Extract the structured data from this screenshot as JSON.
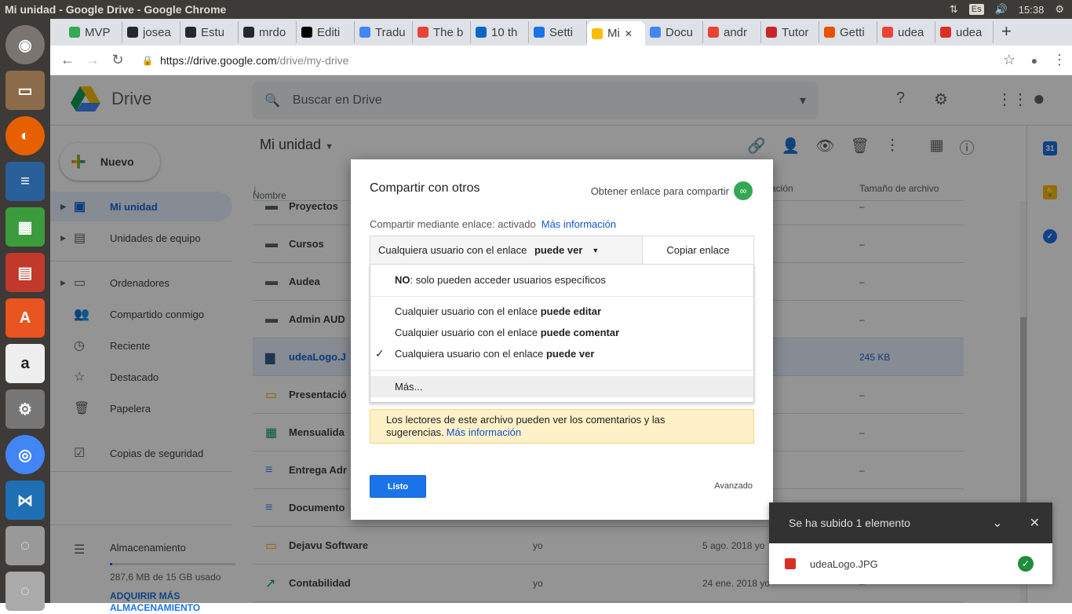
{
  "window": {
    "title": "Mi unidad - Google Drive - Google Chrome",
    "keyboard": "Es",
    "clock": "15:38"
  },
  "tabs": [
    {
      "label": "MVP",
      "color": "#34a853"
    },
    {
      "label": "josea",
      "color": "#24292e"
    },
    {
      "label": "Estu",
      "color": "#24292e"
    },
    {
      "label": "mrdo",
      "color": "#24292e"
    },
    {
      "label": "Editi",
      "color": "#000000"
    },
    {
      "label": "Tradu",
      "color": "#4285f4"
    },
    {
      "label": "The b",
      "color": "#ea4335"
    },
    {
      "label": "10 th",
      "color": "#0a66c2"
    },
    {
      "label": "Setti",
      "color": "#1a73e8"
    },
    {
      "label": "Mi",
      "color": "#fbbc04",
      "active": true
    },
    {
      "label": "Docu",
      "color": "#4285f4"
    },
    {
      "label": "andr",
      "color": "#ea4335"
    },
    {
      "label": "Tutor",
      "color": "#c62828"
    },
    {
      "label": "Getti",
      "color": "#e65100"
    },
    {
      "label": "udea",
      "color": "#ea4335"
    },
    {
      "label": "udea",
      "color": "#d93025"
    }
  ],
  "address": {
    "host": "https://drive.google.com",
    "path": "/drive/my-drive"
  },
  "drive": {
    "app_name": "Drive",
    "search_placeholder": "Buscar en Drive",
    "new_label": "Nuevo",
    "sidebar": [
      {
        "label": "Mi unidad",
        "icon": "drive-folder-icon",
        "selected": true,
        "arrow": true
      },
      {
        "label": "Unidades de equipo",
        "icon": "team-drive-icon",
        "arrow": true
      },
      {
        "label": "Ordenadores",
        "icon": "computers-icon",
        "arrow": true
      },
      {
        "label": "Compartido conmigo",
        "icon": "shared-icon"
      },
      {
        "label": "Reciente",
        "icon": "clock-icon"
      },
      {
        "label": "Destacado",
        "icon": "star-icon"
      },
      {
        "label": "Papelera",
        "icon": "trash-icon"
      },
      {
        "label": "Copias de seguridad",
        "icon": "backup-icon"
      }
    ],
    "storage": {
      "label": "Almacenamiento",
      "used": "287,6 MB de 15 GB usado",
      "buy": "ADQUIRIR MÁS ALMACENAMIENTO",
      "fraction": 0.019
    },
    "title": "Mi unidad",
    "columns": {
      "name": "Nombre",
      "modified": "ación",
      "size": "Tamaño de archivo"
    },
    "files": [
      {
        "name": "Proyectos",
        "icon": "folder-icon",
        "owner": "",
        "modified": "",
        "size": "–"
      },
      {
        "name": "Cursos",
        "icon": "folder-icon",
        "owner": "",
        "modified": "",
        "size": "–"
      },
      {
        "name": "Audea",
        "icon": "shared-folder-icon",
        "owner": "",
        "modified": "",
        "size": "–"
      },
      {
        "name": "Admin AUD",
        "icon": "folder-icon",
        "owner": "",
        "modified": "",
        "size": "–"
      },
      {
        "name": "udeaLogo.J",
        "icon": "image-thumb-icon",
        "owner": "",
        "modified": "",
        "size": "245 KB",
        "selected": true
      },
      {
        "name": "Presentació",
        "icon": "slides-icon",
        "owner": "",
        "modified": "",
        "size": "–"
      },
      {
        "name": "Mensualida",
        "icon": "sheets-icon",
        "owner": "",
        "modified": "",
        "size": "–"
      },
      {
        "name": "Entrega Adr",
        "icon": "docs-icon",
        "owner": "",
        "modified": "",
        "size": "–"
      },
      {
        "name": "Documento",
        "icon": "docs-icon",
        "owner": "",
        "modified": "",
        "size": "–"
      },
      {
        "name": "Dejavu Software",
        "icon": "slides-icon",
        "owner": "yo",
        "modified": "5 ago. 2018 yo",
        "size": "–"
      },
      {
        "name": "Contabilidad",
        "icon": "chart-file-icon",
        "owner": "yo",
        "modified": "24 ene. 2018 yo",
        "size": "–"
      }
    ]
  },
  "dialog": {
    "title": "Compartir con otros",
    "get_link": "Obtener enlace para compartir",
    "link_status": "Compartir mediante enlace: activado",
    "more_info": "Más información",
    "current_prefix": "Cualquiera usuario con el enlace ",
    "current_bold": "puede ver",
    "copy": "Copiar enlace",
    "options": [
      {
        "bold": "NO",
        "rest": ": solo pueden acceder usuarios específicos"
      },
      {
        "text": "Cualquier usuario con el enlace ",
        "bold": "puede editar"
      },
      {
        "text": "Cualquier usuario con el enlace ",
        "bold": "puede comentar"
      },
      {
        "text": "Cualquiera usuario con el enlace ",
        "bold": "puede ver",
        "checked": true
      },
      {
        "text": "Más..."
      }
    ],
    "warning": "Los lectores de este archivo pueden ver los comentarios y las sugerencias.",
    "warning_link": "Más información",
    "done": "Listo",
    "advanced": "Avanzado"
  },
  "upload": {
    "title": "Se ha subido 1 elemento",
    "file": "udeaLogo.JPG"
  }
}
